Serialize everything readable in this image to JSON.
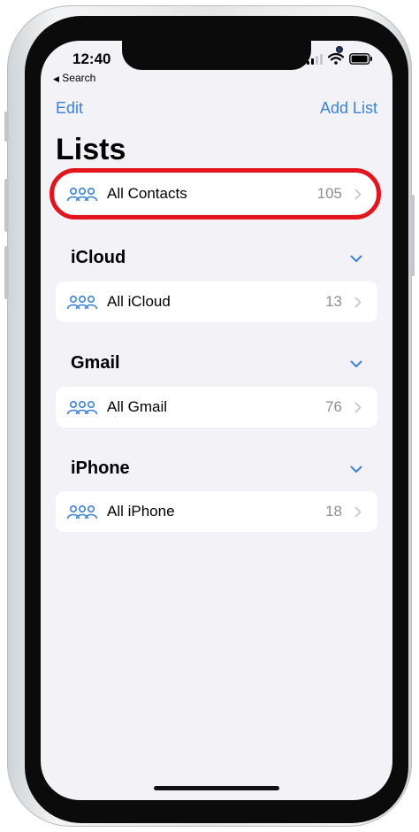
{
  "status_bar": {
    "time": "12:40",
    "back_label": "Search"
  },
  "nav": {
    "edit_label": "Edit",
    "add_list_label": "Add List"
  },
  "page": {
    "title": "Lists"
  },
  "top_row": {
    "label": "All Contacts",
    "count": "105"
  },
  "sections": [
    {
      "title": "iCloud",
      "row_label": "All iCloud",
      "row_count": "13"
    },
    {
      "title": "Gmail",
      "row_label": "All Gmail",
      "row_count": "76"
    },
    {
      "title": "iPhone",
      "row_label": "All iPhone",
      "row_count": "18"
    }
  ],
  "colors": {
    "accent": "#3a82d6",
    "highlight": "#e3141b",
    "background": "#f2f2f7",
    "secondary_text": "#8e8e93"
  },
  "icons": {
    "group": "people-group-icon",
    "chevron_right": "chevron-right-icon",
    "chevron_down": "chevron-down-icon"
  }
}
